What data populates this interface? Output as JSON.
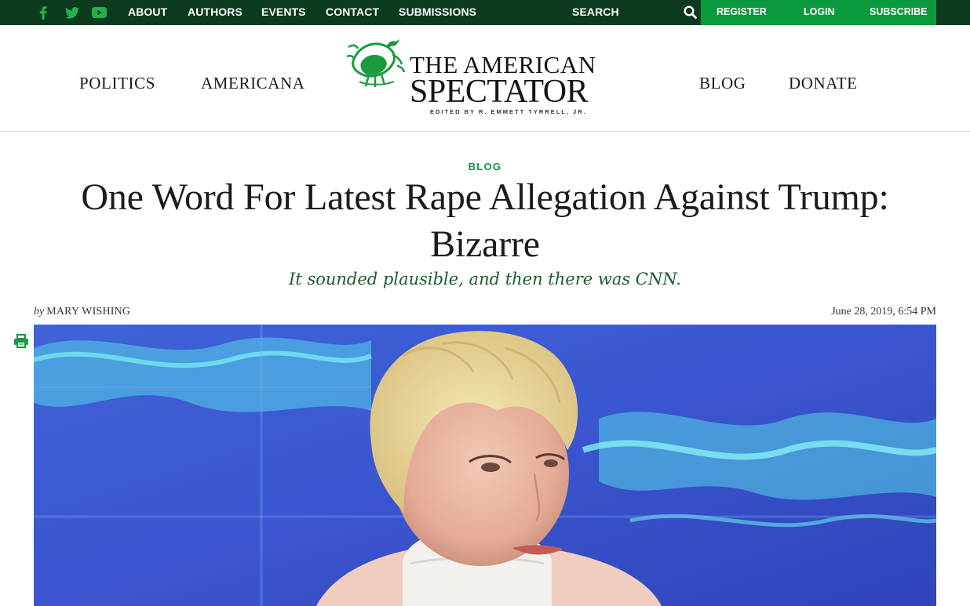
{
  "topbar": {
    "social": [
      {
        "name": "facebook-icon"
      },
      {
        "name": "twitter-icon"
      },
      {
        "name": "youtube-icon"
      }
    ],
    "nav": [
      "ABOUT",
      "AUTHORS",
      "EVENTS",
      "CONTACT",
      "SUBMISSIONS"
    ],
    "search_label": "SEARCH",
    "account": [
      "REGISTER",
      "LOGIN",
      "SUBSCRIBE"
    ],
    "colors": {
      "bar": "#0b3a1f",
      "account_bg": "#0a9a3b"
    }
  },
  "masthead": {
    "nav_left": [
      "POLITICS",
      "AMERICANA"
    ],
    "nav_right": [
      "BLOG",
      "DONATE"
    ],
    "logo": {
      "line1": "THE AMERICAN",
      "line2": "SPECTATOR",
      "line3": "EDITED BY R. EMMETT TYRRELL, JR."
    }
  },
  "article": {
    "category": "BLOG",
    "headline": "One Word For Latest Rape Allegation Against Trump: Bizarre",
    "subhead": "It sounded plausible, and then there was CNN.",
    "by_prefix": "by",
    "author": "MARY WISHING",
    "date": "June 28, 2019, 6:54 PM",
    "print_icon": "print-icon",
    "hero_image": "photo of a woman with short blonde hair in front of a blue screen"
  },
  "colors": {
    "accent": "#0a9a3b",
    "subhead": "#1d5c2a"
  }
}
